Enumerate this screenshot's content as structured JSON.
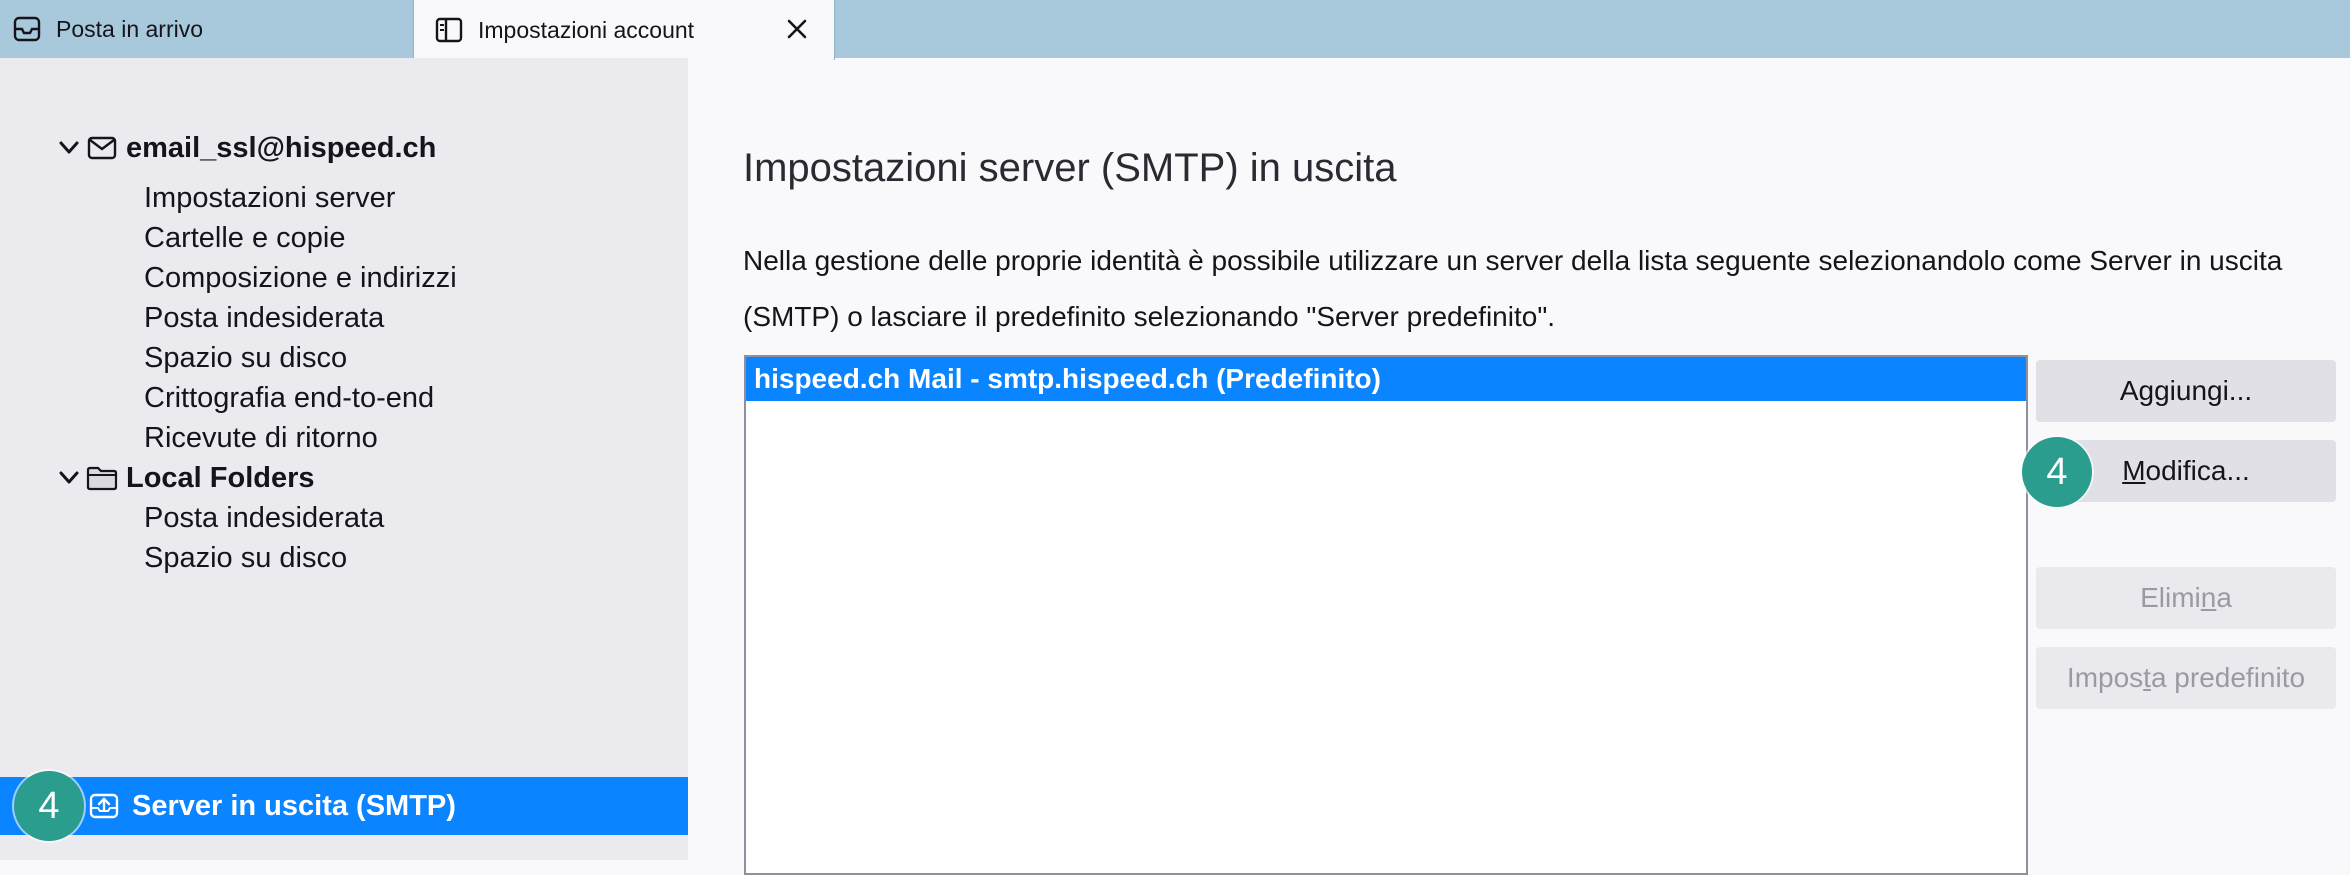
{
  "tabs": [
    {
      "label": "Posta in arrivo",
      "icon": "inbox-icon"
    },
    {
      "label": "Impostazioni account",
      "icon": "settings-page-icon",
      "active": true
    }
  ],
  "sidebar": {
    "accounts": [
      {
        "name": "email_ssl@hispeed.ch",
        "icon": "mail-account-icon",
        "items": [
          "Impostazioni server",
          "Cartelle e copie",
          "Composizione e indirizzi",
          "Posta indesiderata",
          "Spazio su disco",
          "Crittografia end-to-end",
          "Ricevute di ritorno"
        ]
      },
      {
        "name": "Local Folders",
        "icon": "folder-icon",
        "items": [
          "Posta indesiderata",
          "Spazio su disco"
        ]
      }
    ],
    "selected": {
      "label": "Server in uscita (SMTP)",
      "icon": "outgoing-server-icon"
    }
  },
  "main": {
    "title": "Impostazioni server (SMTP) in uscita",
    "description": "Nella gestione delle proprie identità è possibile utilizzare un server della lista seguente selezionandolo come Server in uscita (SMTP) o lasciare il predefinito selezionando \"Server predefinito\".",
    "servers": [
      "hispeed.ch Mail - smtp.hispeed.ch (Predefinito)"
    ],
    "buttons": {
      "add": "Aggiungi...",
      "edit_ul": "M",
      "edit_rest": "odifica...",
      "delete_pre": "Elimi",
      "delete_ul": "n",
      "delete_post": "a",
      "default_pre": "Impos",
      "default_ul": "t",
      "default_post": "a predefinito"
    }
  },
  "step_badge": "4",
  "colors": {
    "accent": "#0a84ff",
    "badge": "#2a9d8f",
    "tabbar": "#a8c9db"
  }
}
